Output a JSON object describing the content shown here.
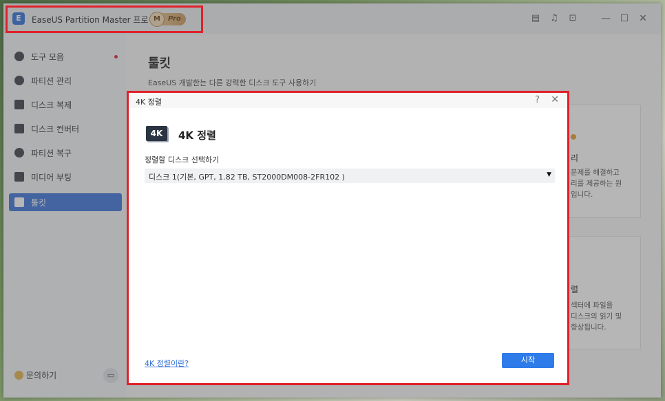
{
  "app": {
    "title": "EaseUS Partition Master 프로 버전",
    "badge_m": "M",
    "badge_pro": "Pro",
    "highlight_color": "#e0202a",
    "accent_color": "#3a73d9"
  },
  "titlebar_icons": [
    "notes-icon",
    "bell-icon",
    "export-icon",
    "minimize-icon",
    "maximize-icon",
    "close-icon"
  ],
  "sidebar": {
    "items": [
      {
        "label": "도구 모음",
        "icon": "compass-icon"
      },
      {
        "label": "파티션 관리",
        "icon": "pie-icon"
      },
      {
        "label": "디스크 복제",
        "icon": "clone-icon"
      },
      {
        "label": "디스크 컨버터",
        "icon": "disk-convert-icon"
      },
      {
        "label": "파티션 복구",
        "icon": "recover-icon"
      },
      {
        "label": "미디어 부팅",
        "icon": "media-boot-icon"
      },
      {
        "label": "툴킷",
        "icon": "toolbox-icon"
      }
    ],
    "help_label": "문의하기"
  },
  "main": {
    "title": "툴킷",
    "subtitle": "EaseUS 개발한는 다른 강력한 디스크 도구 사용하기",
    "card1": {
      "title": "리",
      "text": [
        "문제를 해결하고",
        "리를 제공하는 원",
        "입니다."
      ]
    },
    "card2": {
      "title": "렬",
      "text": [
        "섹터에 파일을",
        "디스크의 읽기 및",
        "향상됩니다."
      ]
    }
  },
  "dialog": {
    "window_title": "4K 정렬",
    "help_glyph": "?",
    "close_glyph": "✕",
    "badge": "4K",
    "heading": "4K 정렬",
    "field_label": "정렬할 디스크 선택하기",
    "select_value": "디스크 1(기본, GPT, 1.82 TB, ST2000DM008-2FR102 )",
    "link": "4K 정렬이란?",
    "start_button": "시작"
  }
}
